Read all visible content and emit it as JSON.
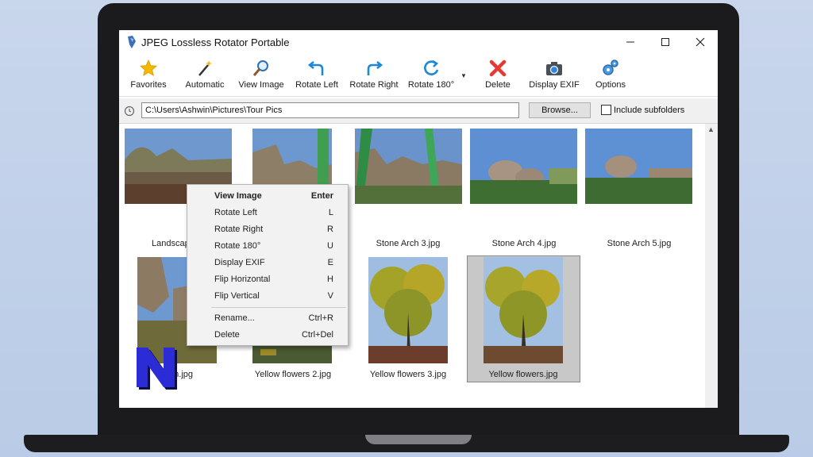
{
  "window": {
    "title": "JPEG Lossless Rotator Portable"
  },
  "toolbar": {
    "buttons": [
      {
        "label": "Favorites",
        "icon": "star-icon"
      },
      {
        "label": "Automatic",
        "icon": "magic-wand-icon"
      },
      {
        "label": "View Image",
        "icon": "magnifier-icon"
      },
      {
        "label": "Rotate Left",
        "icon": "rotate-left-icon"
      },
      {
        "label": "Rotate Right",
        "icon": "rotate-right-icon"
      },
      {
        "label": "Rotate 180°",
        "icon": "rotate-180-icon"
      },
      {
        "label": "Delete",
        "icon": "delete-x-icon"
      },
      {
        "label": "Display EXIF",
        "icon": "camera-icon"
      },
      {
        "label": "Options",
        "icon": "gears-icon"
      }
    ]
  },
  "pathbar": {
    "path": "C:\\Users\\Ashwin\\Pictures\\Tour Pics",
    "browse_label": "Browse...",
    "include_subfolders_label": "Include subfolders"
  },
  "thumbnails": [
    {
      "caption": "Landscape.jpg"
    },
    {
      "caption": ""
    },
    {
      "caption": "Stone Arch 3.jpg"
    },
    {
      "caption": "Stone Arch 4.jpg"
    },
    {
      "caption": "Stone Arch 5.jpg"
    },
    {
      "caption": "Stone Arch.jpg"
    },
    {
      "caption": "Yellow flowers 2.jpg"
    },
    {
      "caption": "Yellow flowers 3.jpg"
    },
    {
      "caption": "Yellow flowers.jpg"
    }
  ],
  "captions": {
    "landscape_visible": "Landscap",
    "stone_arch_visible": "rch.jpg"
  },
  "context_menu": {
    "items": [
      {
        "label": "View Image",
        "shortcut": "Enter"
      },
      {
        "label": "Rotate Left",
        "shortcut": "L"
      },
      {
        "label": "Rotate Right",
        "shortcut": "R"
      },
      {
        "label": "Rotate 180°",
        "shortcut": "U"
      },
      {
        "label": "Display EXIF",
        "shortcut": "E"
      },
      {
        "label": "Flip Horizontal",
        "shortcut": "H"
      },
      {
        "label": "Flip Vertical",
        "shortcut": "V"
      },
      {
        "label": "Rename...",
        "shortcut": "Ctrl+R"
      },
      {
        "label": "Delete",
        "shortcut": "Ctrl+Del"
      }
    ]
  },
  "colors": {
    "accent_blue": "#1e88d8",
    "delete_red": "#e53935",
    "star_yellow": "#f5b800",
    "logo_blue": "#2c2cd6"
  },
  "watermark": {
    "letter": "N"
  }
}
